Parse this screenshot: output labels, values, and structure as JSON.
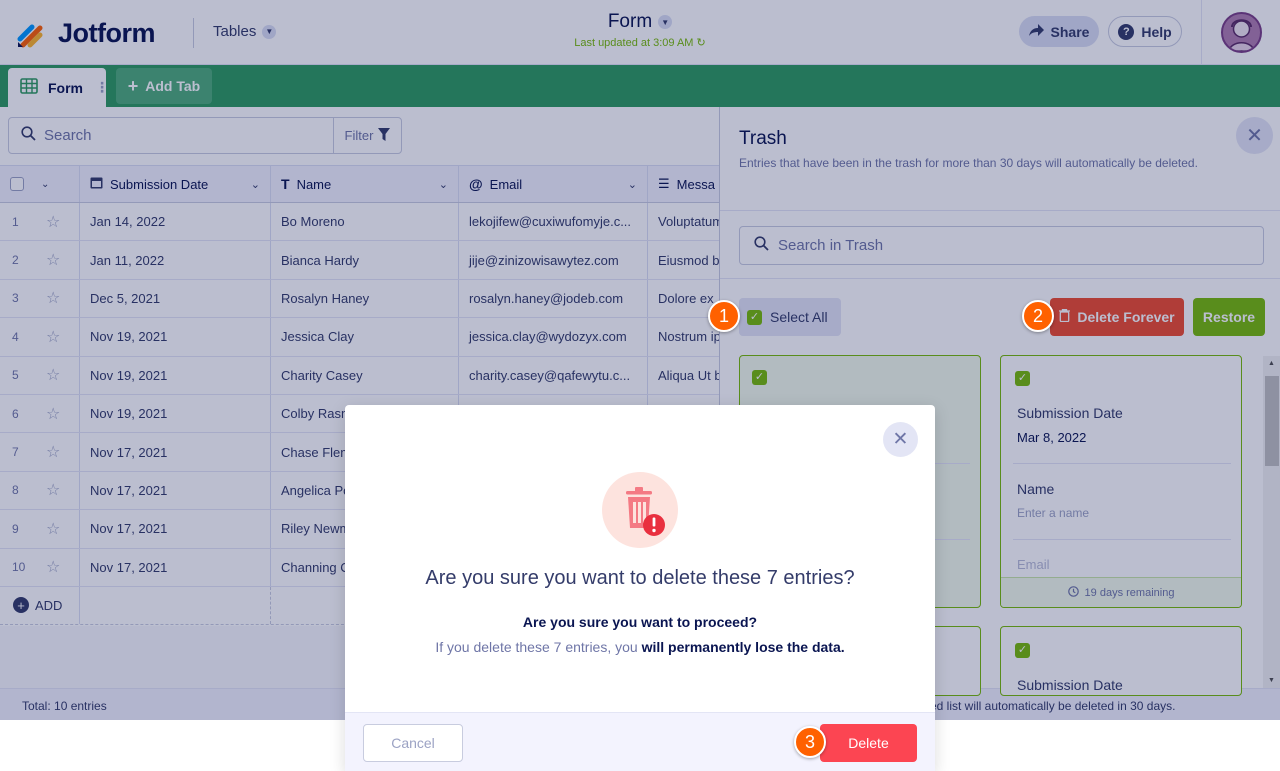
{
  "header": {
    "logo_text": "Jotform",
    "tables_label": "Tables",
    "form_title": "Form",
    "last_updated": "Last updated at 3:09 AM",
    "share_label": "Share",
    "help_label": "Help"
  },
  "tabs": {
    "form_label": "Form",
    "add_tab_label": "Add Tab"
  },
  "toolbar": {
    "search_placeholder": "Search",
    "filter_label": "Filter"
  },
  "grid": {
    "columns": [
      "Submission Date",
      "Name",
      "Email",
      "Messa"
    ],
    "rows": [
      {
        "num": "1",
        "date": "Jan 14, 2022",
        "name": "Bo Moreno",
        "email": "lekojifew@cuxiwufomyje.c...",
        "msg": "Voluptatum"
      },
      {
        "num": "2",
        "date": "Jan 11, 2022",
        "name": "Bianca Hardy",
        "email": "jije@zinizowisawytez.com",
        "msg": "Eiusmod b"
      },
      {
        "num": "3",
        "date": "Dec 5, 2021",
        "name": "Rosalyn Haney",
        "email": "rosalyn.haney@jodeb.com",
        "msg": "Dolore ex"
      },
      {
        "num": "4",
        "date": "Nov 19, 2021",
        "name": "Jessica Clay",
        "email": "jessica.clay@wydozyx.com",
        "msg": "Nostrum ip"
      },
      {
        "num": "5",
        "date": "Nov 19, 2021",
        "name": "Charity Casey",
        "email": "charity.casey@qafewytu.c...",
        "msg": "Aliqua Ut b"
      },
      {
        "num": "6",
        "date": "Nov 19, 2021",
        "name": "Colby Rasmu",
        "email": "",
        "msg": ""
      },
      {
        "num": "7",
        "date": "Nov 17, 2021",
        "name": "Chase Flem",
        "email": "",
        "msg": ""
      },
      {
        "num": "8",
        "date": "Nov 17, 2021",
        "name": "Angelica Po",
        "email": "",
        "msg": ""
      },
      {
        "num": "9",
        "date": "Nov 17, 2021",
        "name": "Riley Newm",
        "email": "",
        "msg": ""
      },
      {
        "num": "10",
        "date": "Nov 17, 2021",
        "name": "Channing C",
        "email": "",
        "msg": ""
      }
    ],
    "add_label": "ADD"
  },
  "footer": {
    "total": "Total: 10 entries",
    "note": "ed list will automatically be deleted in 30 days."
  },
  "trash": {
    "title": "Trash",
    "description": "Entries that have been in the trash for more than 30 days will automatically be deleted.",
    "search_placeholder": "Search in Trash",
    "select_all_label": "Select All",
    "delete_forever_label": "Delete Forever",
    "restore_label": "Restore",
    "card": {
      "date_label": "Submission Date",
      "date_value": "Mar 8, 2022",
      "name_label": "Name",
      "name_placeholder": "Enter a name",
      "email_label": "Email",
      "remaining": "19 days remaining"
    },
    "card2": {
      "date_label": "Submission Date"
    }
  },
  "modal": {
    "title": "Are you sure you want to delete these 7 entries?",
    "question": "Are you sure you want to proceed?",
    "sub_prefix": "If you delete these 7 entries, you ",
    "sub_bold": "will permanently lose the data.",
    "cancel_label": "Cancel",
    "delete_label": "Delete"
  },
  "steps": [
    "1",
    "2",
    "3"
  ],
  "colors": {
    "brand_green": "#2f9b5f",
    "accent_green": "#78bb07",
    "danger": "#f04d2f",
    "delete_red": "#fc4552",
    "step_orange": "#ff6100",
    "navy": "#0a1551"
  }
}
